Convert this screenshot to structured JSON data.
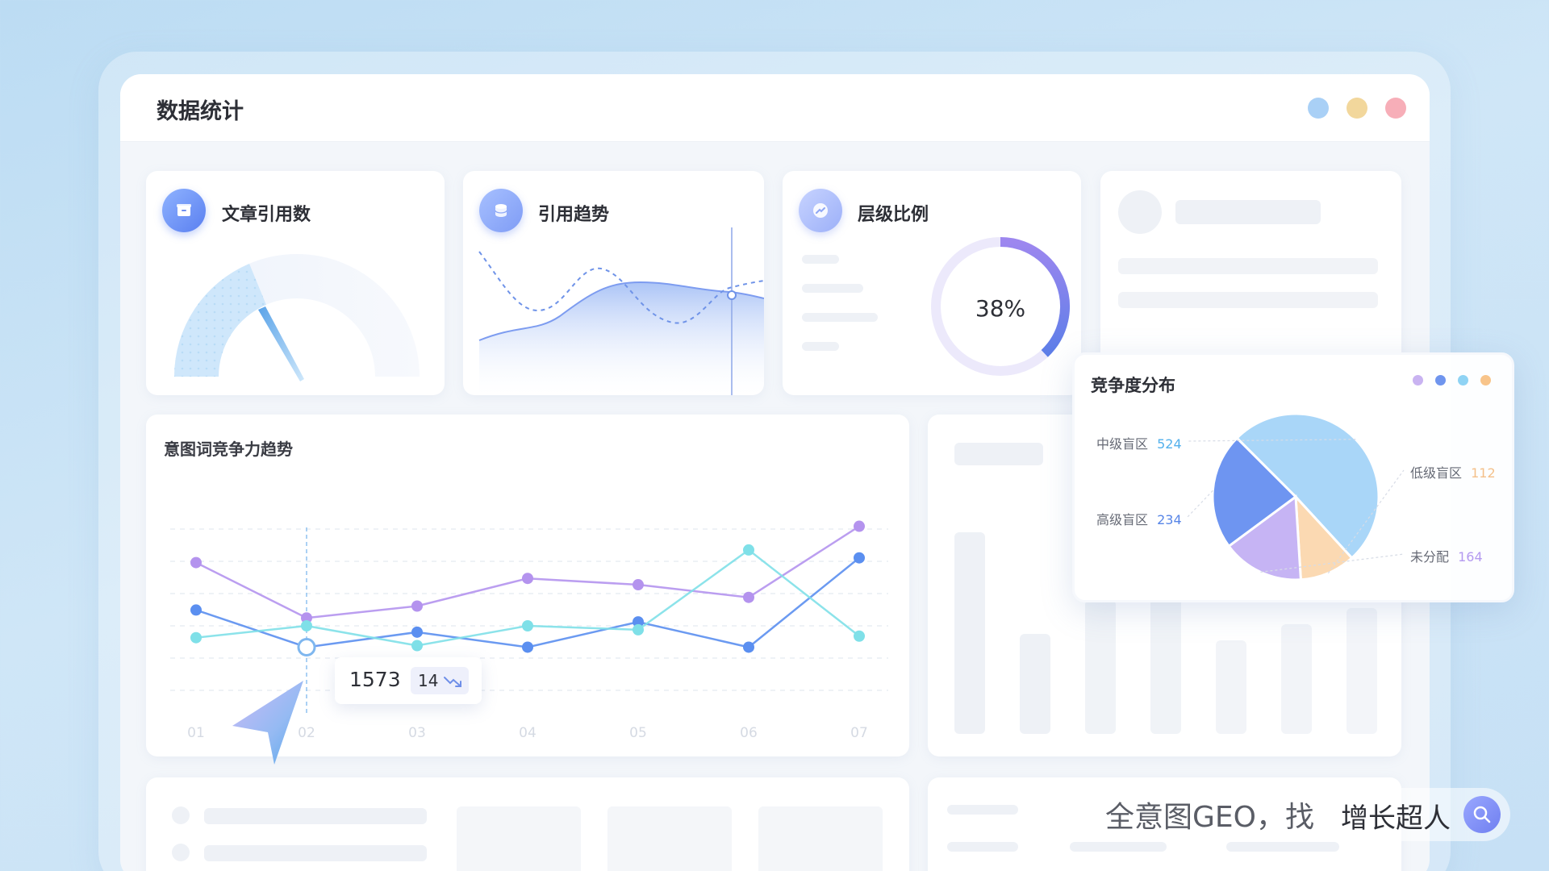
{
  "window": {
    "title": "数据统计",
    "dots": [
      "#a9d0f6",
      "#f2d79c",
      "#f7aeb8"
    ]
  },
  "cards": {
    "article_citations": {
      "title": "文章引用数",
      "icon": "archive-icon"
    },
    "citation_trend": {
      "title": "引用趋势",
      "icon": "database-icon"
    },
    "level_ratio": {
      "title": "层级比例",
      "icon": "trend-up-icon",
      "percent": "38%",
      "value": 0.38
    }
  },
  "trend_chart": {
    "title": "意图词竞争力趋势",
    "tooltip": {
      "value": "1573",
      "delta": "14"
    }
  },
  "competition": {
    "title": "竞争度分布",
    "dots": [
      "#c9b3f1",
      "#6f95ee",
      "#8fd3f4",
      "#f8c48a"
    ],
    "labels": [
      {
        "name": "中级盲区",
        "value": "524",
        "color": "#52b0ec"
      },
      {
        "name": "高级盲区",
        "value": "234",
        "color": "#5785e7"
      },
      {
        "name": "低级盲区",
        "value": "112",
        "color": "#f4c08a"
      },
      {
        "name": "未分配",
        "value": "164",
        "color": "#b49af0"
      }
    ]
  },
  "brand": {
    "prefix": "全意图GEO，找",
    "name": "增长超人"
  },
  "chart_data": [
    {
      "type": "line",
      "title": "意图词竞争力趋势",
      "categories": [
        "01",
        "02",
        "03",
        "04",
        "05",
        "06",
        "07"
      ],
      "series": [
        {
          "color": "#b493ee",
          "values": [
            1680,
            1610,
            1625,
            1660,
            1652,
            1636,
            1726
          ]
        },
        {
          "color": "#5b8ff0",
          "values": [
            1620,
            1573,
            1592,
            1573,
            1605,
            1573,
            1686
          ]
        },
        {
          "color": "#7fe0e8",
          "values": [
            1585,
            1600,
            1575,
            1600,
            1595,
            1696,
            1587
          ]
        }
      ],
      "ylim": [
        1500,
        1750
      ]
    },
    {
      "type": "pie",
      "title": "竞争度分布",
      "labels": [
        "中级盲区",
        "高级盲区",
        "低级盲区",
        "未分配"
      ],
      "values": [
        524,
        234,
        112,
        164
      ]
    }
  ]
}
